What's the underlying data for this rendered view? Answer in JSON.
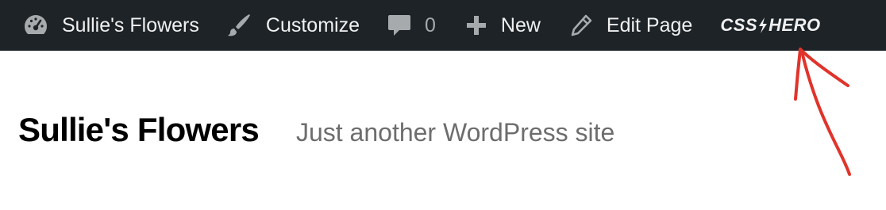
{
  "adminbar": {
    "site_name": "Sullie's Flowers",
    "customize": "Customize",
    "comments_count": "0",
    "new": "New",
    "edit_page": "Edit Page",
    "css_hero_1": "CSS",
    "css_hero_2": "HERO",
    "icons": [
      "dashboard-icon",
      "paintbrush-icon",
      "comment-icon",
      "plus-icon",
      "pencil-icon",
      "bolt-icon"
    ]
  },
  "header": {
    "site_title": "Sullie's Flowers",
    "tagline": "Just another WordPress site"
  },
  "colors": {
    "adminbar_bg": "#1d2327",
    "adminbar_text": "#f0f0f1",
    "muted": "#a7aaad",
    "tagline": "#6d6d6d",
    "annotation_arrow": "#e0342b"
  }
}
